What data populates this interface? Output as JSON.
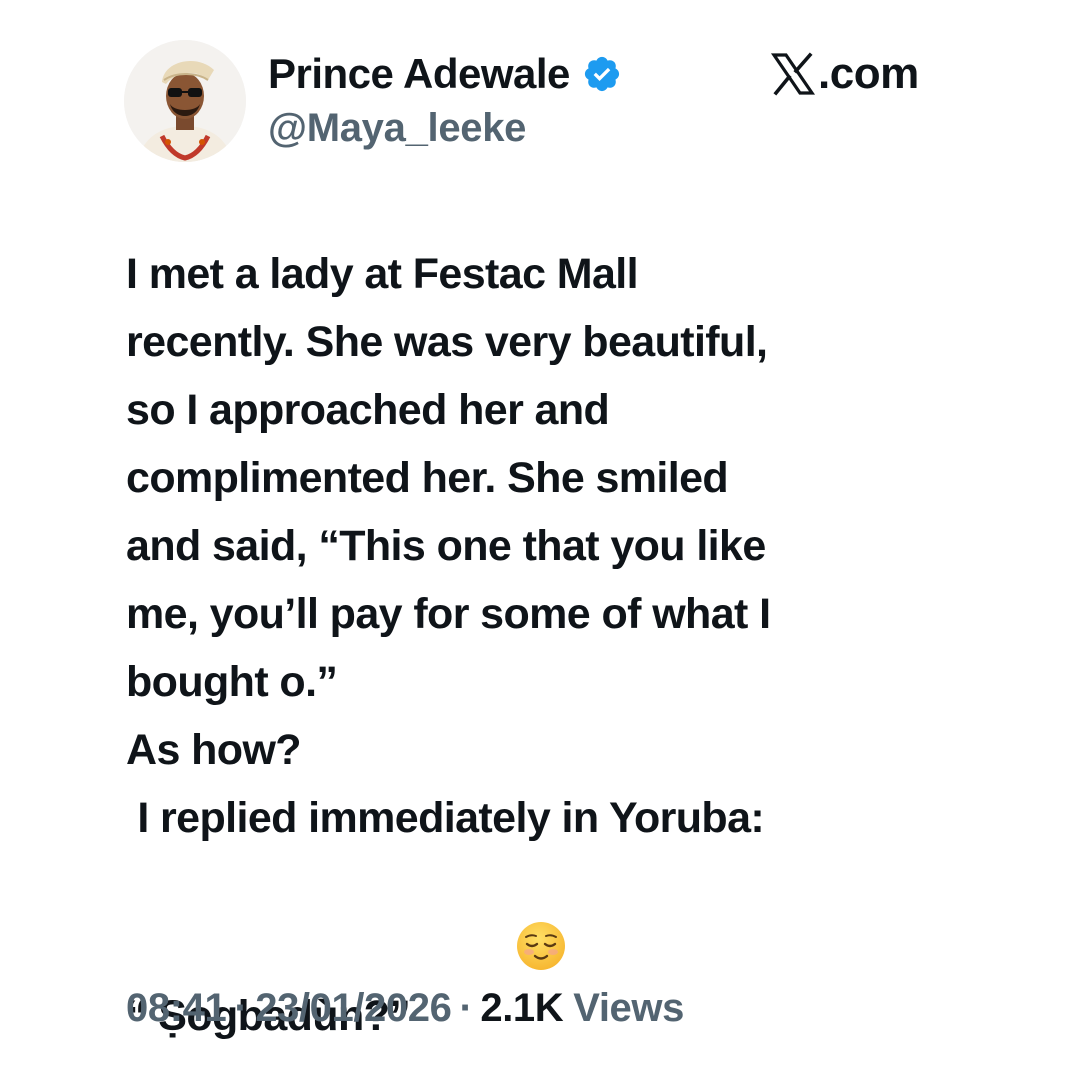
{
  "author": {
    "display_name": "Prince Adewale",
    "handle": "@Maya_leeke",
    "verified": true,
    "verified_icon": "verified-badge-icon",
    "avatar_icon": "profile-photo"
  },
  "site": {
    "logo_icon": "x-logo-icon",
    "domain_suffix": ".com"
  },
  "tweet": {
    "lines": [
      "I met a lady at Festac Mall",
      "recently. She was very beautiful,",
      "so I approached her and",
      "complimented her. She smiled",
      "and said, “This one that you like",
      "me, you’ll pay for some of what I",
      "bought o.”",
      "As how?",
      " I replied immediately in Yoruba:",
      "“ Ṣogbadùn?”"
    ],
    "trailing_emoji": "relieved-face-emoji"
  },
  "meta": {
    "time": "08:41",
    "separator": "·",
    "date": "23/01/2026",
    "view_count": "2.1K",
    "views_label": "Views"
  },
  "colors": {
    "text_primary": "#0f1419",
    "text_secondary": "#536471",
    "verified_blue": "#1d9bf0",
    "background": "#ffffff"
  }
}
